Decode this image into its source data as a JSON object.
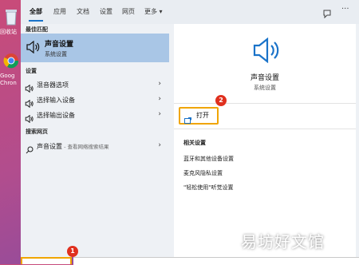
{
  "desktop": {
    "icon1_label": "回收站",
    "icon2_label": "Goog",
    "icon2_label2": "Chron"
  },
  "tabs": [
    {
      "label": "全部",
      "active": true
    },
    {
      "label": "应用"
    },
    {
      "label": "文档"
    },
    {
      "label": "设置"
    },
    {
      "label": "网页"
    },
    {
      "label": "更多 ▾"
    }
  ],
  "left": {
    "best_match_header": "最佳匹配",
    "best_match": {
      "title": "声音设置",
      "subtitle": "系统设置",
      "icon": "speaker-icon"
    },
    "settings_header": "设置",
    "settings_items": [
      {
        "label": "混音器选项",
        "icon": "speaker-icon"
      },
      {
        "label": "选择输入设备",
        "icon": "speaker-icon"
      },
      {
        "label": "选择输出设备",
        "icon": "speaker-icon"
      }
    ],
    "web_header": "搜索网页",
    "web_item": {
      "label": "声音设置",
      "sub": " - 查看网络搜索结果",
      "icon": "search-icon"
    }
  },
  "right": {
    "title": "声音设置",
    "subtitle": "系统设置",
    "open_label": "打开",
    "related_header": "相关设置",
    "related_links": [
      "蓝牙和其他设备设置",
      "麦克风隐私设置",
      "\"轻松使用\"听觉设置"
    ]
  },
  "badges": {
    "one": "1",
    "two": "2"
  },
  "watermark": "易坊好文馆",
  "colors": {
    "accent": "#1a73c9",
    "highlight": "#a9c6e6",
    "badge": "#e0301e",
    "callout": "#f0a500"
  }
}
